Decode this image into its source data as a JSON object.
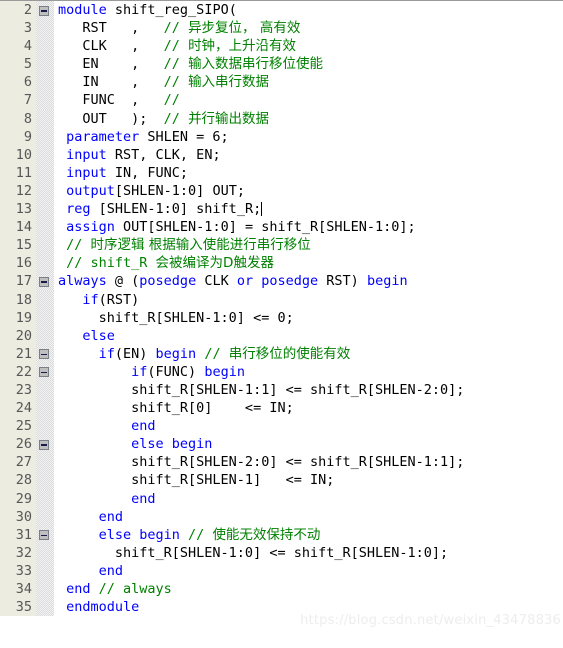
{
  "editor": {
    "language": "Verilog",
    "first_line_number": 2,
    "last_line_number": 35,
    "caret_line": 13,
    "colors": {
      "background": "#FFFFFF",
      "gutter_background": "#ECECE1",
      "gutter_text": "#575757",
      "keyword": "#0000FF",
      "comment": "#008000",
      "plain": "#000000",
      "fold_marker": "#BFBFBF"
    }
  },
  "watermark": {
    "text": "https://blog.csdn.net/weixin_43478836"
  },
  "lines": [
    {
      "num": "2",
      "fold": true,
      "tokens": [
        {
          "t": "kw",
          "v": "module"
        },
        {
          "t": "pl",
          "v": " shift_reg_SIPO("
        }
      ]
    },
    {
      "num": "3",
      "fold": false,
      "tokens": [
        {
          "t": "pl",
          "v": "   RST   ,   "
        },
        {
          "t": "cm",
          "v": "// "
        },
        {
          "t": "cjk",
          "v": "异步复位， 高有效"
        }
      ]
    },
    {
      "num": "4",
      "fold": false,
      "tokens": [
        {
          "t": "pl",
          "v": "   CLK   ,   "
        },
        {
          "t": "cm",
          "v": "// "
        },
        {
          "t": "cjk",
          "v": "时钟，上升沿有效"
        }
      ]
    },
    {
      "num": "5",
      "fold": false,
      "tokens": [
        {
          "t": "pl",
          "v": "   EN    ,   "
        },
        {
          "t": "cm",
          "v": "// "
        },
        {
          "t": "cjk",
          "v": "输入数据串行移位使能"
        }
      ]
    },
    {
      "num": "6",
      "fold": false,
      "tokens": [
        {
          "t": "pl",
          "v": "   IN    ,   "
        },
        {
          "t": "cm",
          "v": "// "
        },
        {
          "t": "cjk",
          "v": "输入串行数据"
        }
      ]
    },
    {
      "num": "7",
      "fold": false,
      "tokens": [
        {
          "t": "pl",
          "v": "   FUNC  ,   "
        },
        {
          "t": "cm",
          "v": "//"
        }
      ]
    },
    {
      "num": "8",
      "fold": false,
      "tokens": [
        {
          "t": "pl",
          "v": "   OUT   );  "
        },
        {
          "t": "cm",
          "v": "// "
        },
        {
          "t": "cjk",
          "v": "并行输出数据"
        }
      ]
    },
    {
      "num": "9",
      "fold": false,
      "tokens": [
        {
          "t": "kw",
          "v": " parameter"
        },
        {
          "t": "pl",
          "v": " SHLEN = 6;"
        }
      ]
    },
    {
      "num": "10",
      "fold": false,
      "tokens": [
        {
          "t": "kw",
          "v": " input"
        },
        {
          "t": "pl",
          "v": " RST, CLK, EN;"
        }
      ]
    },
    {
      "num": "11",
      "fold": false,
      "tokens": [
        {
          "t": "kw",
          "v": " input"
        },
        {
          "t": "pl",
          "v": " IN, FUNC;"
        }
      ]
    },
    {
      "num": "12",
      "fold": false,
      "tokens": [
        {
          "t": "kw",
          "v": " output"
        },
        {
          "t": "pl",
          "v": "[SHLEN-1:0] OUT;"
        }
      ]
    },
    {
      "num": "13",
      "fold": false,
      "caret": true,
      "tokens": [
        {
          "t": "kw",
          "v": " reg"
        },
        {
          "t": "pl",
          "v": " [SHLEN-1:0] shift_R;"
        }
      ]
    },
    {
      "num": "14",
      "fold": false,
      "tokens": [
        {
          "t": "kw",
          "v": " assign"
        },
        {
          "t": "pl",
          "v": " OUT[SHLEN-1:0] = shift_R[SHLEN-1:0];"
        }
      ]
    },
    {
      "num": "15",
      "fold": false,
      "tokens": [
        {
          "t": "cm",
          "v": " // "
        },
        {
          "t": "cjk",
          "v": "时序逻辑 根据输入使能进行串行移位"
        }
      ]
    },
    {
      "num": "16",
      "fold": false,
      "tokens": [
        {
          "t": "cm",
          "v": " // shift_R "
        },
        {
          "t": "cjk",
          "v": "会被编译为D触发器"
        }
      ]
    },
    {
      "num": "17",
      "fold": true,
      "tokens": [
        {
          "t": "kw",
          "v": "always"
        },
        {
          "t": "pl",
          "v": " @ ("
        },
        {
          "t": "kw",
          "v": "posedge"
        },
        {
          "t": "pl",
          "v": " CLK "
        },
        {
          "t": "kw",
          "v": "or"
        },
        {
          "t": "pl",
          "v": " "
        },
        {
          "t": "kw",
          "v": "posedge"
        },
        {
          "t": "pl",
          "v": " RST) "
        },
        {
          "t": "kw",
          "v": "begin"
        }
      ]
    },
    {
      "num": "18",
      "fold": false,
      "tokens": [
        {
          "t": "pl",
          "v": "   "
        },
        {
          "t": "kw",
          "v": "if"
        },
        {
          "t": "pl",
          "v": "(RST)"
        }
      ]
    },
    {
      "num": "19",
      "fold": false,
      "tokens": [
        {
          "t": "pl",
          "v": "     shift_R[SHLEN-1:0] <= 0;"
        }
      ]
    },
    {
      "num": "20",
      "fold": false,
      "tokens": [
        {
          "t": "pl",
          "v": "   "
        },
        {
          "t": "kw",
          "v": "else"
        }
      ]
    },
    {
      "num": "21",
      "fold": true,
      "tokens": [
        {
          "t": "pl",
          "v": "     "
        },
        {
          "t": "kw",
          "v": "if"
        },
        {
          "t": "pl",
          "v": "(EN) "
        },
        {
          "t": "kw",
          "v": "begin"
        },
        {
          "t": "cm",
          "v": " // "
        },
        {
          "t": "cjk",
          "v": "串行移位的使能有效"
        }
      ]
    },
    {
      "num": "22",
      "fold": true,
      "tokens": [
        {
          "t": "pl",
          "v": "         "
        },
        {
          "t": "kw",
          "v": "if"
        },
        {
          "t": "pl",
          "v": "(FUNC) "
        },
        {
          "t": "kw",
          "v": "begin"
        }
      ]
    },
    {
      "num": "23",
      "fold": false,
      "tokens": [
        {
          "t": "pl",
          "v": "         shift_R[SHLEN-1:1] <= shift_R[SHLEN-2:0];"
        }
      ]
    },
    {
      "num": "24",
      "fold": false,
      "tokens": [
        {
          "t": "pl",
          "v": "         shift_R[0]    <= IN;"
        }
      ]
    },
    {
      "num": "25",
      "fold": false,
      "tokens": [
        {
          "t": "pl",
          "v": "         "
        },
        {
          "t": "kw",
          "v": "end"
        }
      ]
    },
    {
      "num": "26",
      "fold": true,
      "tokens": [
        {
          "t": "pl",
          "v": "         "
        },
        {
          "t": "kw",
          "v": "else begin"
        }
      ]
    },
    {
      "num": "27",
      "fold": false,
      "tokens": [
        {
          "t": "pl",
          "v": "         shift_R[SHLEN-2:0] <= shift_R[SHLEN-1:1];"
        }
      ]
    },
    {
      "num": "28",
      "fold": false,
      "tokens": [
        {
          "t": "pl",
          "v": "         shift_R[SHLEN-1]   <= IN;"
        }
      ]
    },
    {
      "num": "29",
      "fold": false,
      "tokens": [
        {
          "t": "pl",
          "v": "         "
        },
        {
          "t": "kw",
          "v": "end"
        }
      ]
    },
    {
      "num": "30",
      "fold": false,
      "tokens": [
        {
          "t": "pl",
          "v": "     "
        },
        {
          "t": "kw",
          "v": "end"
        }
      ]
    },
    {
      "num": "31",
      "fold": true,
      "tokens": [
        {
          "t": "pl",
          "v": "     "
        },
        {
          "t": "kw",
          "v": "else begin"
        },
        {
          "t": "cm",
          "v": " // "
        },
        {
          "t": "cjk",
          "v": "使能无效保持不动"
        }
      ]
    },
    {
      "num": "32",
      "fold": false,
      "tokens": [
        {
          "t": "pl",
          "v": "       shift_R[SHLEN-1:0] <= shift_R[SHLEN-1:0];"
        }
      ]
    },
    {
      "num": "33",
      "fold": false,
      "tokens": [
        {
          "t": "pl",
          "v": "     "
        },
        {
          "t": "kw",
          "v": "end"
        }
      ]
    },
    {
      "num": "34",
      "fold": false,
      "tokens": [
        {
          "t": "kw",
          "v": " end"
        },
        {
          "t": "cm",
          "v": " // always"
        }
      ]
    },
    {
      "num": "35",
      "fold": false,
      "tokens": [
        {
          "t": "kw",
          "v": " endmodule"
        }
      ]
    }
  ]
}
